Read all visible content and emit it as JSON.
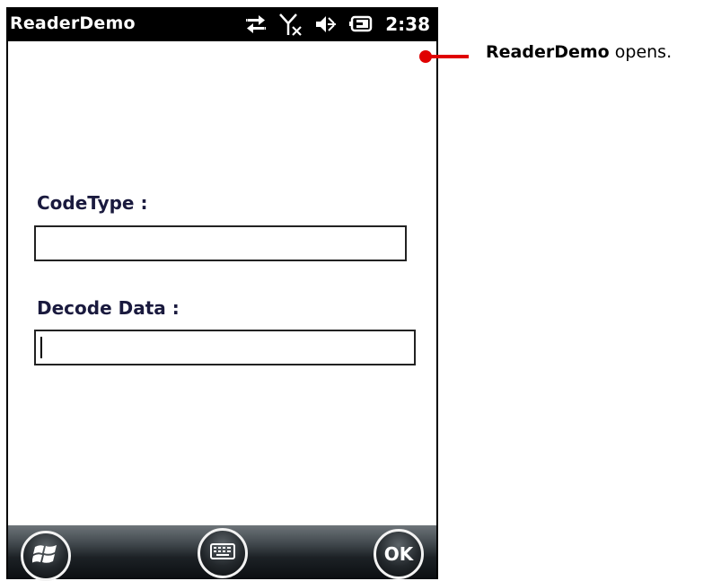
{
  "app": {
    "title": "ReaderDemo"
  },
  "status_bar": {
    "time": "2:38",
    "icons": [
      "data-sync-icon",
      "no-signal-icon",
      "speaker-muted-icon",
      "battery-charging-icon"
    ]
  },
  "form": {
    "codetype_label": "CodeType :",
    "codetype_value": "",
    "decode_label": "Decode Data :",
    "decode_value": ""
  },
  "bottom_bar": {
    "ok_label": "OK",
    "buttons": [
      "windows-start-icon",
      "keyboard-icon",
      "ok-button"
    ]
  },
  "annotation": {
    "bold_text": "ReaderDemo",
    "rest_text": " opens."
  },
  "colors": {
    "callout": "#e00000",
    "label_text": "#1a1a3e",
    "statusbar_bg": "#000000"
  }
}
